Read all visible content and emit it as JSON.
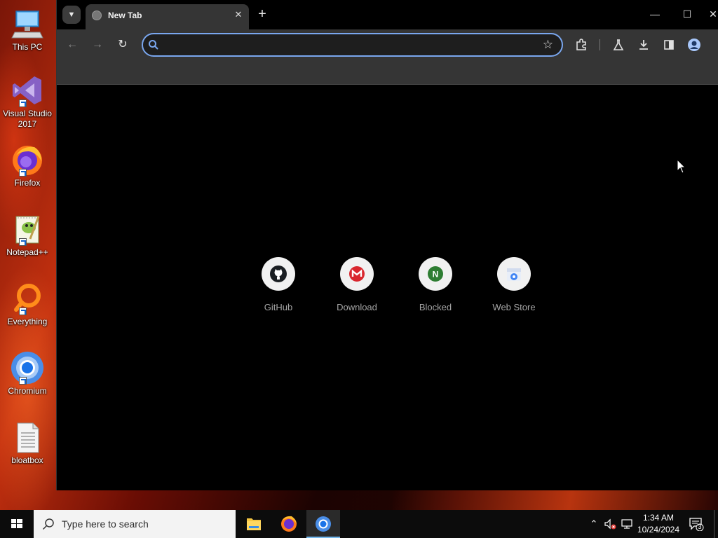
{
  "desktop": {
    "icons": [
      {
        "label": "This PC",
        "icon": "this-pc-icon"
      },
      {
        "label": "Visual Studio 2017",
        "icon": "visual-studio-icon"
      },
      {
        "label": "Firefox",
        "icon": "firefox-icon"
      },
      {
        "label": "Notepad++",
        "icon": "notepad-plus-plus-icon"
      },
      {
        "label": "Everything",
        "icon": "everything-icon"
      },
      {
        "label": "Chromium",
        "icon": "chromium-icon"
      },
      {
        "label": "bloatbox",
        "icon": "text-file-icon"
      }
    ]
  },
  "browser": {
    "tab": {
      "title": "New Tab"
    },
    "omnibox": {
      "value": "",
      "placeholder": ""
    },
    "shortcuts": [
      {
        "label": "GitHub",
        "icon": "github-icon"
      },
      {
        "label": "Download",
        "icon": "mega-icon",
        "color": "#d9272e"
      },
      {
        "label": "Blocked",
        "icon": "n-letter-icon",
        "color": "#2e7d32"
      },
      {
        "label": "Web Store",
        "icon": "web-store-icon",
        "color": "#4285f4"
      }
    ]
  },
  "taskbar": {
    "search_placeholder": "Type here to search",
    "clock_time": "1:34 AM",
    "clock_date": "10/24/2024",
    "notification_count": "3"
  },
  "colors": {
    "omnibox_focus": "#7aa7ef",
    "toolbar_bg": "#353535",
    "taskbar_active_underline": "#76b9ed"
  }
}
